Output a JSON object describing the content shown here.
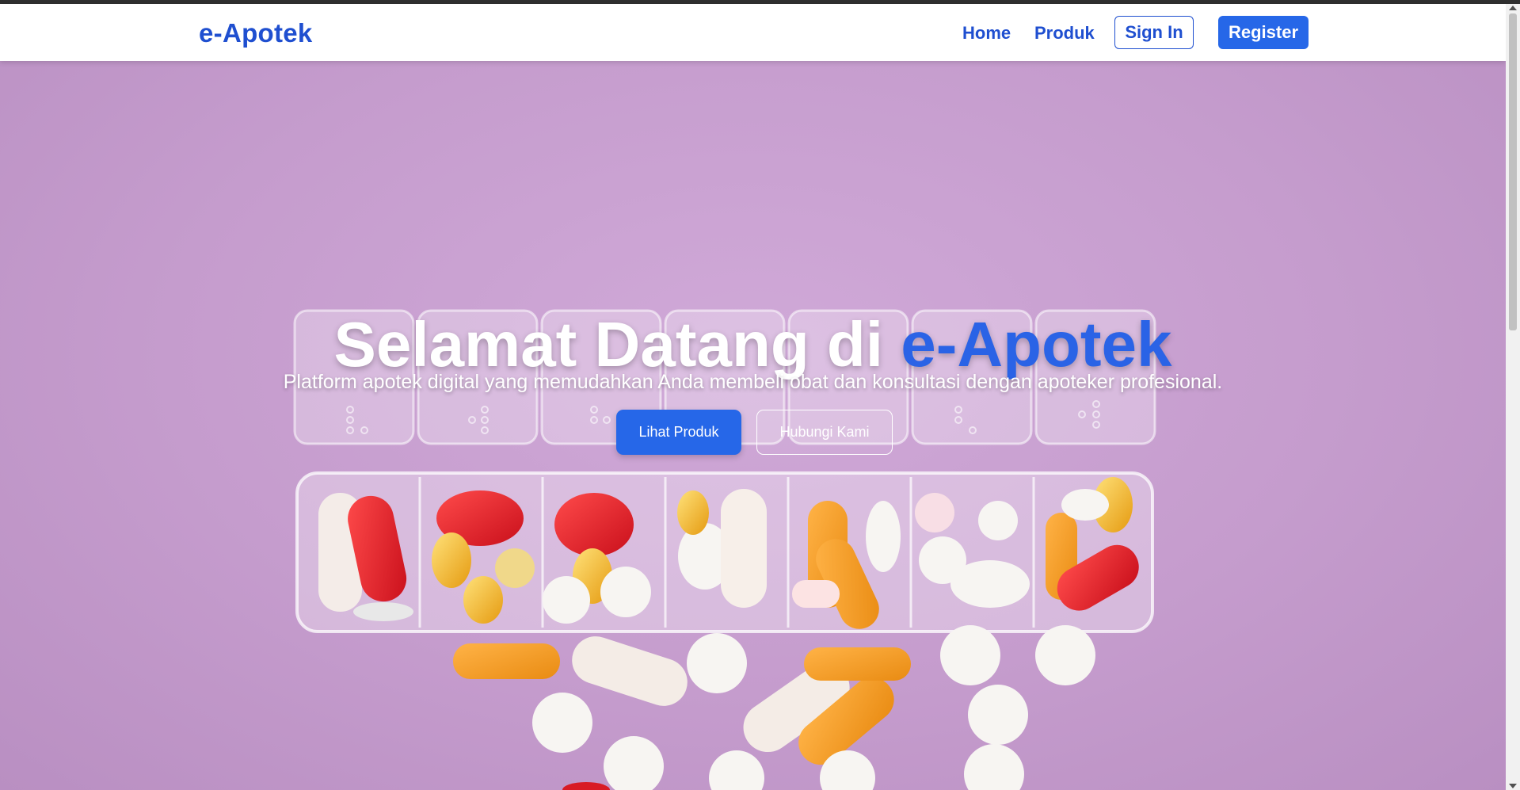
{
  "navbar": {
    "brand": "e-Apotek",
    "links": [
      "Home",
      "Produk"
    ],
    "signin_label": "Sign In",
    "register_label": "Register"
  },
  "hero": {
    "title_prefix": "Selamat Datang di ",
    "title_accent": "e-Apotek",
    "subtitle": "Platform apotek digital yang memudahkan Anda membeli obat dan konsultasi dengan apoteker profesional.",
    "primary_button": "Lihat Produk",
    "secondary_button": "Hubungi Kami"
  },
  "colors": {
    "brand": "#1f4fd0",
    "accent": "#2667e8",
    "hero_background": "#c79ccf"
  }
}
